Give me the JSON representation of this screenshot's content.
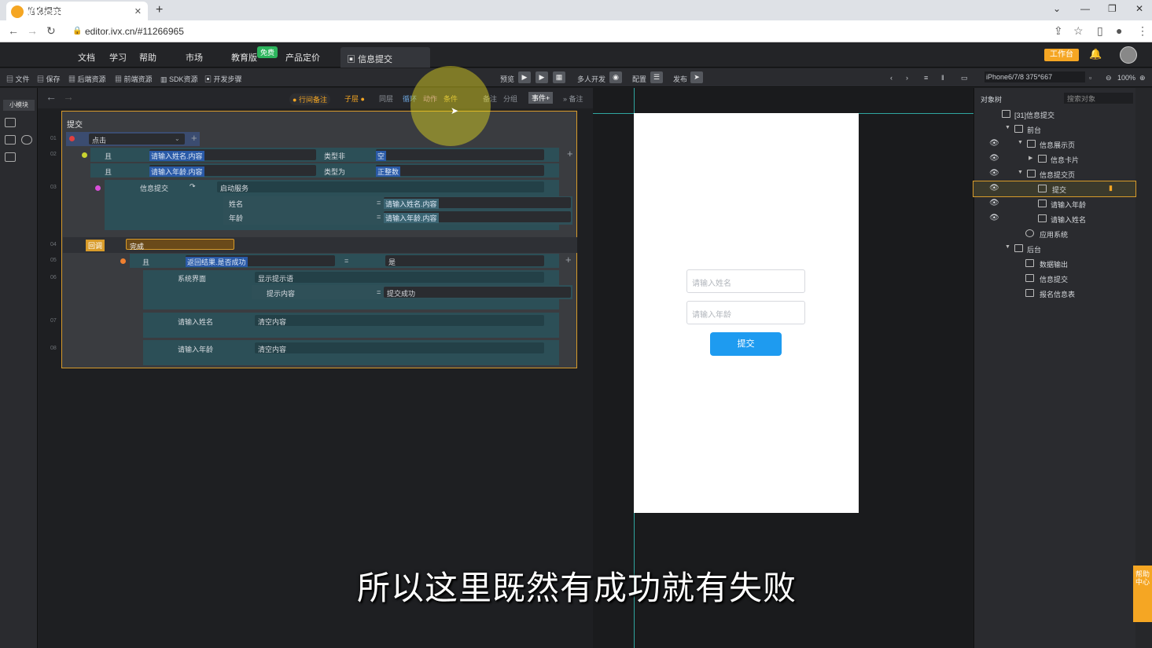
{
  "browser": {
    "tab_title": "信息提交",
    "url": "editor.ivx.cn/#11266965"
  },
  "header": {
    "logo": "VX.cn",
    "menu": [
      "文档",
      "学习",
      "帮助",
      "市场",
      "教育版",
      "产品定价"
    ],
    "free_badge": "免费",
    "current_tab": "信息提交",
    "workbench": "工作台"
  },
  "toolbar": {
    "items": [
      "文件",
      "保存",
      "后端资源",
      "前端资源",
      "SDK资源",
      "开发步骤"
    ],
    "preview": "预览",
    "multi_dev": "多人开发",
    "config": "配置",
    "publish": "发布",
    "device": "iPhone6/7/8 375*667",
    "zoom": "100%"
  },
  "left": {
    "small_module": "小模块"
  },
  "editor_bar": {
    "row_comment": "行间备注",
    "sub_layer": "子层",
    "same_level": "同层",
    "loop": "循环",
    "action": "动作",
    "condition": "条件",
    "comment": "备注",
    "group": "分组",
    "event": "事件+",
    "note": "备注"
  },
  "logic": {
    "node_title": "提交",
    "rows": {
      "event": "点击",
      "and": "且",
      "name_content": "请输入姓名.内容",
      "type_not": "类型非",
      "empty": "空",
      "age_content": "请输入年龄.内容",
      "type_is": "类型为",
      "positive_int": "正整数",
      "info_submit": "信息提交",
      "start_service": "启动服务",
      "param_name": "姓名",
      "param_age": "年龄",
      "eq": "=",
      "callback": "回调",
      "complete": "完成",
      "return_success": "返回结果.是否成功",
      "yes": "是",
      "system_ui": "系统界面",
      "show_tip": "显示提示语",
      "tip_content": "提示内容",
      "submit_success": "提交成功",
      "name_input": "请输入姓名",
      "age_input": "请输入年龄",
      "clear_content": "清空内容"
    }
  },
  "preview": {
    "name_placeholder": "请输入姓名",
    "age_placeholder": "请输入年龄",
    "submit": "提交"
  },
  "tree": {
    "tab": "对象树",
    "search_placeholder": "搜索对象",
    "items": [
      "[31]信息提交",
      "前台",
      "信息展示页",
      "信息卡片",
      "信息提交页",
      "提交",
      "请输入年龄",
      "请输入姓名",
      "应用系统",
      "后台",
      "数据输出",
      "信息提交",
      "报名信息表"
    ]
  },
  "help_dock": "帮助中心",
  "subtitle": "所以这里既然有成功就有失败"
}
